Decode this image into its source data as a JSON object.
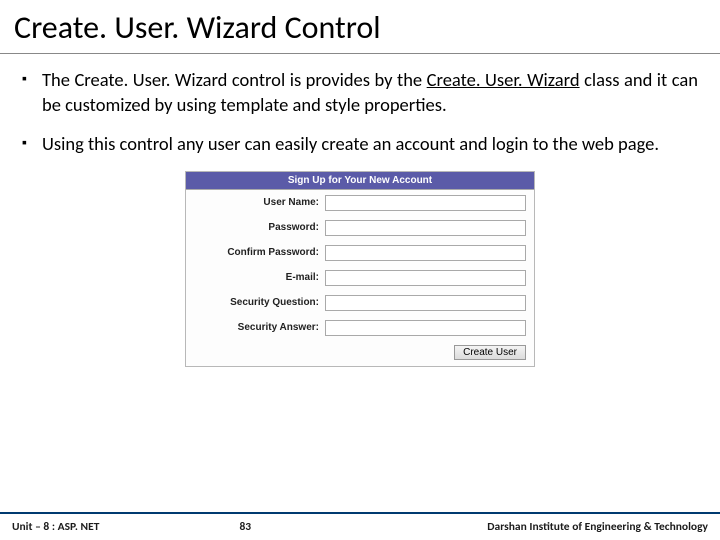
{
  "title": "Create. User. Wizard Control",
  "bullets": {
    "b1_pre": "The Create. User. Wizard control is provides by the ",
    "b1_underlined": "Create. User. Wizard",
    "b1_post": " class and it can be customized by using template and style properties.",
    "b2": "Using this control any user can easily create an account and login to the web page."
  },
  "form": {
    "header": "Sign Up for Your New Account",
    "labels": {
      "username": "User Name:",
      "password": "Password:",
      "confirm": "Confirm Password:",
      "email": "E-mail:",
      "secq": "Security Question:",
      "seca": "Security Answer:"
    },
    "button": "Create User"
  },
  "footer": {
    "left": "Unit – 8 : ASP. NET",
    "page": "83",
    "right": "Darshan Institute of Engineering & Technology"
  }
}
